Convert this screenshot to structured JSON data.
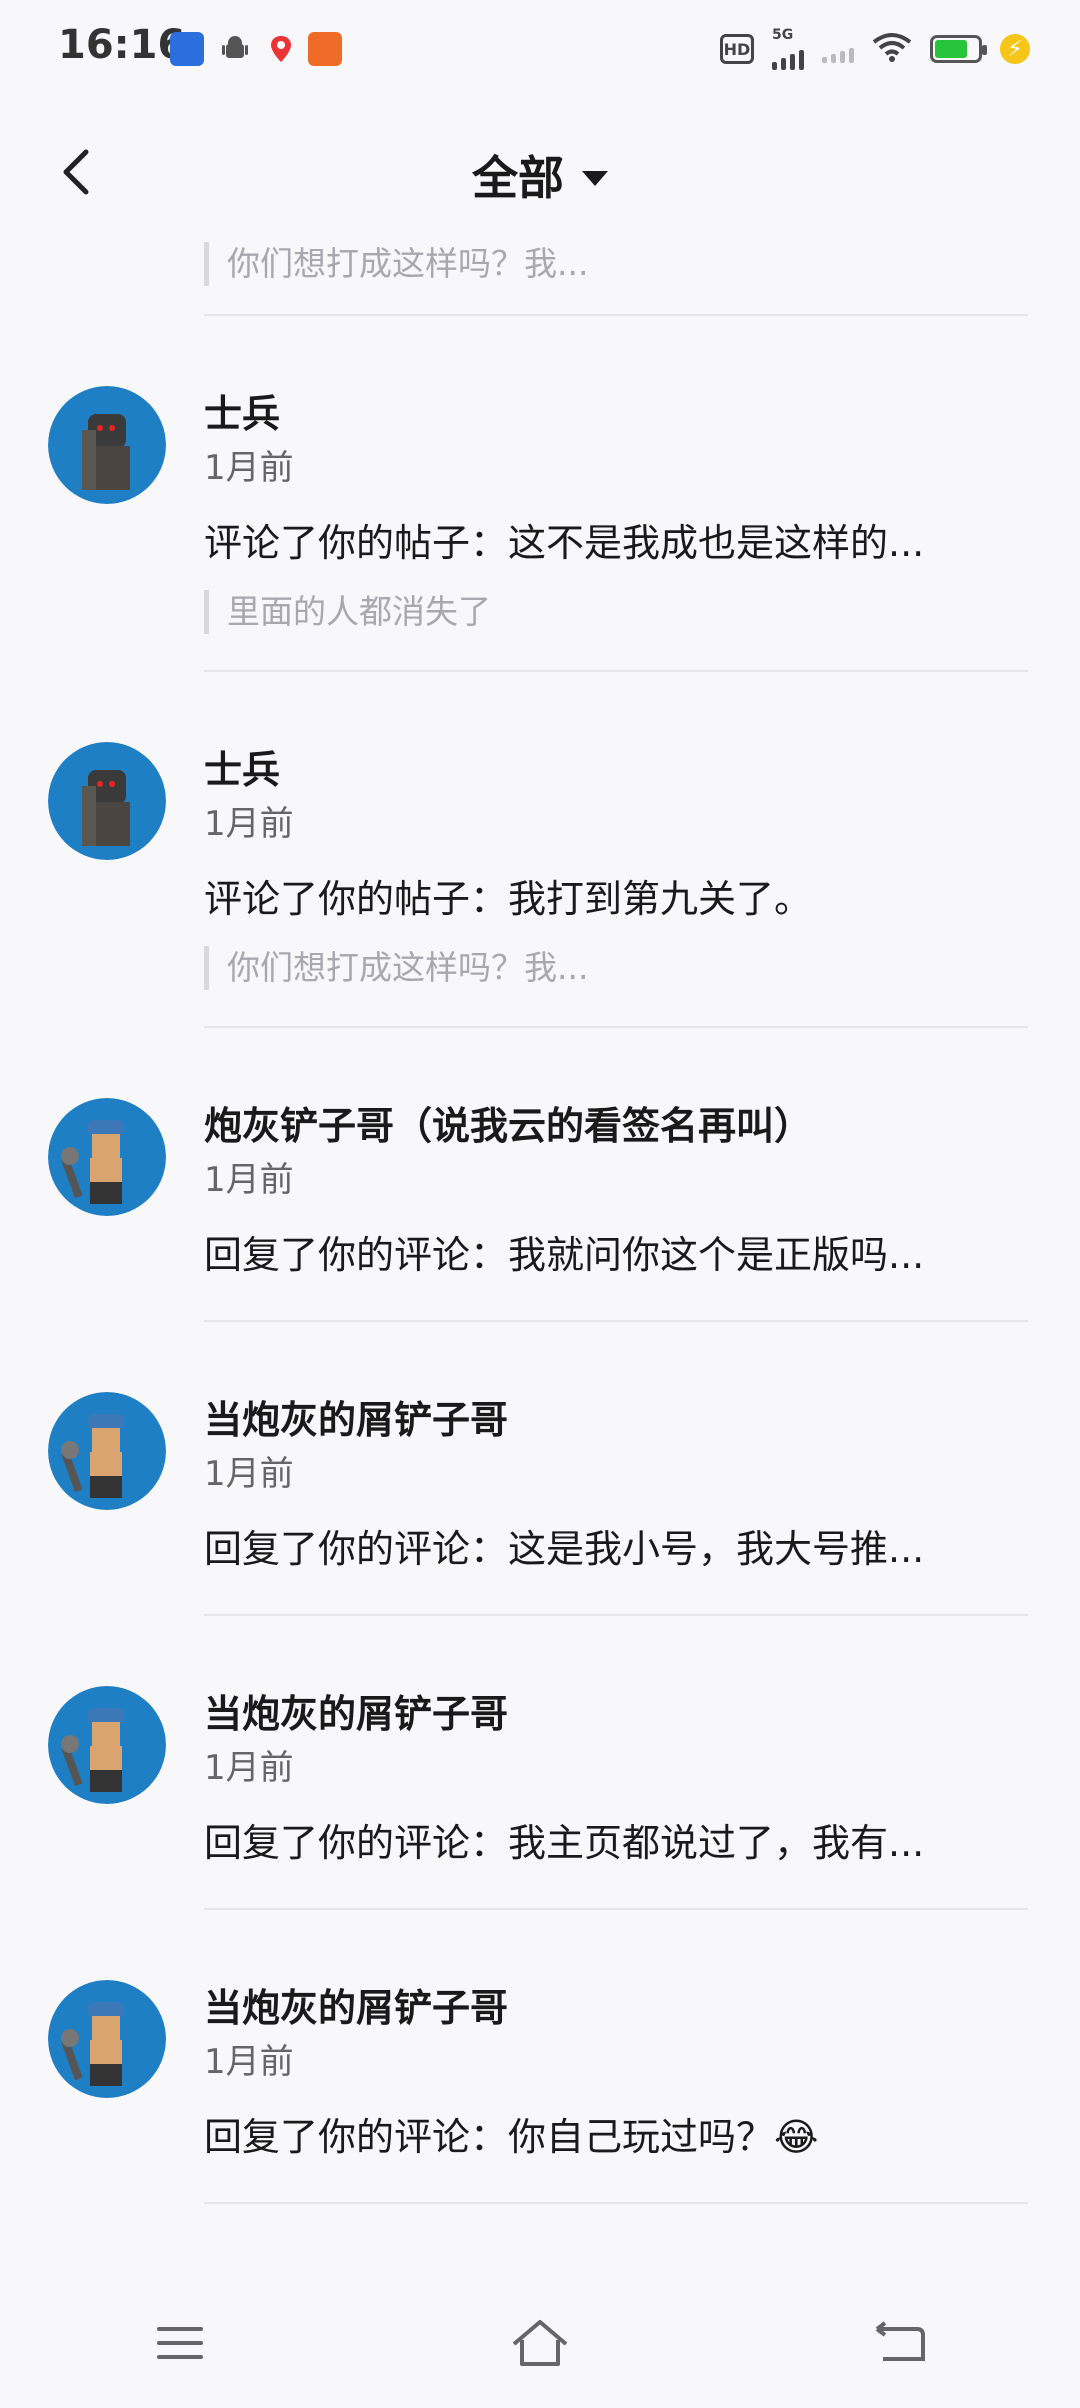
{
  "status_bar": {
    "time": "16:16",
    "network": "5G",
    "hd_label": "HD",
    "icons": [
      "baidu-app-icon",
      "android-icon",
      "maps-pin-icon",
      "orange-app-icon"
    ]
  },
  "header": {
    "title": "全部",
    "back_icon": "chevron-left-icon",
    "dropdown_icon": "caret-down-icon"
  },
  "notifications": [
    {
      "type": "partial",
      "quote": "你们想打成这样吗？我..."
    },
    {
      "name": "士兵",
      "time": "1月前",
      "message": "评论了你的帖子：这不是我成也是这样的...",
      "quote": "里面的人都消失了",
      "avatar": "soldier"
    },
    {
      "name": "士兵",
      "time": "1月前",
      "message": "评论了你的帖子：我打到第九关了。",
      "quote": "你们想打成这样吗？我...",
      "avatar": "soldier"
    },
    {
      "name": "炮灰铲子哥（说我云的看签名再叫）",
      "time": "1月前",
      "message": "回复了你的评论：我就问你这个是正版吗...",
      "avatar": "shovel"
    },
    {
      "name": "当炮灰的屑铲子哥",
      "time": "1月前",
      "message": "回复了你的评论：这是我小号，我大号推...",
      "avatar": "shovel"
    },
    {
      "name": "当炮灰的屑铲子哥",
      "time": "1月前",
      "message": "回复了你的评论：我主页都说过了，我有...",
      "avatar": "shovel"
    },
    {
      "name": "当炮灰的屑铲子哥",
      "time": "1月前",
      "message": "回复了你的评论：你自己玩过吗？😂",
      "avatar": "shovel"
    }
  ],
  "nav_bar": {
    "icons": [
      "menu-icon",
      "home-icon",
      "back-icon"
    ]
  }
}
